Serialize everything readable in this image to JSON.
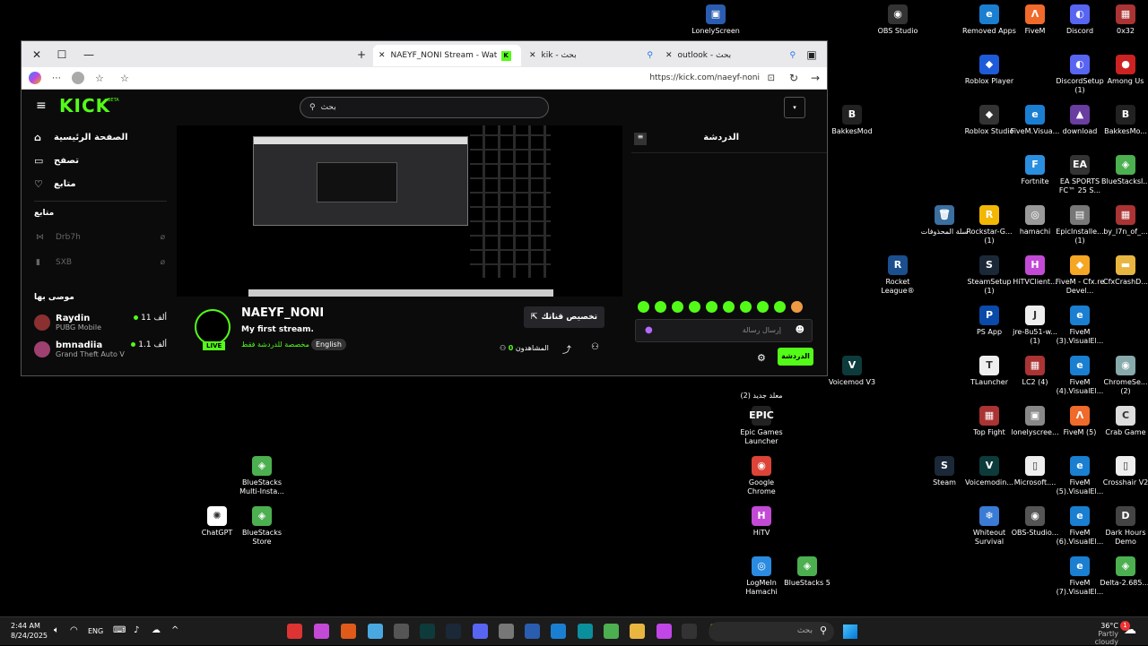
{
  "desktop_icons": [
    {
      "label": "LonelyScreen",
      "color": "#2a5db0",
      "glyph": "▣"
    },
    {
      "label": "OBS Studio",
      "color": "#333",
      "glyph": "◉"
    },
    {
      "label": "Removed Apps",
      "color": "#1a7fd1",
      "glyph": "e"
    },
    {
      "label": "FiveM",
      "color": "#f06a2b",
      "glyph": "Λ"
    },
    {
      "label": "Discord",
      "color": "#5865f2",
      "glyph": "◐"
    },
    {
      "label": "0x32",
      "color": "#a33",
      "glyph": "▦"
    },
    {
      "label": "Roblox Player",
      "color": "#1e5bd8",
      "glyph": "◆"
    },
    {
      "label": "DiscordSetup (1)",
      "color": "#5865f2",
      "glyph": "◐"
    },
    {
      "label": "Among Us",
      "color": "#c22",
      "glyph": "●"
    },
    {
      "label": "BakkesMod",
      "color": "#222",
      "glyph": "B"
    },
    {
      "label": "Roblox Studio",
      "color": "#333",
      "glyph": "◆"
    },
    {
      "label": "FiveM.Visua...",
      "color": "#1a7fd1",
      "glyph": "e"
    },
    {
      "label": "download",
      "color": "#6a3da0",
      "glyph": "▲"
    },
    {
      "label": "BakkesMo...",
      "color": "#222",
      "glyph": "B"
    },
    {
      "label": "Fortnite",
      "color": "#2b8fe0",
      "glyph": "F"
    },
    {
      "label": "EA SPORTS FC™ 25 S...",
      "color": "#333",
      "glyph": "EA"
    },
    {
      "label": "BlueStacksI...",
      "color": "#4caf50",
      "glyph": "◈"
    },
    {
      "label": "سلة المحذوفات",
      "color": "#3a6fa0",
      "glyph": "🗑"
    },
    {
      "label": "Rockstar-G... (1)",
      "color": "#f2b705",
      "glyph": "R"
    },
    {
      "label": "hamachi",
      "color": "#999",
      "glyph": "◎"
    },
    {
      "label": "EpicInstalle... (1)",
      "color": "#777",
      "glyph": "▤"
    },
    {
      "label": "by_l7n_of_...",
      "color": "#a33",
      "glyph": "▦"
    },
    {
      "label": "Rocket League®",
      "color": "#1b4f8f",
      "glyph": "R"
    },
    {
      "label": "SteamSetup (1)",
      "color": "#1b2838",
      "glyph": "S"
    },
    {
      "label": "HiTVClient...",
      "color": "#c34ad6",
      "glyph": "H"
    },
    {
      "label": "FiveM - Cfx.re Devel...",
      "color": "#f5a623",
      "glyph": "◆"
    },
    {
      "label": "CfxCrashD...",
      "color": "#e8b640",
      "glyph": "▬"
    },
    {
      "label": "PS App",
      "color": "#0a4aa8",
      "glyph": "P"
    },
    {
      "label": "jre-8u51-w... (1)",
      "color": "#eee",
      "glyph": "J"
    },
    {
      "label": "FiveM (3).VisualEl...",
      "color": "#1a7fd1",
      "glyph": "e"
    },
    {
      "label": "Voicemod V3",
      "color": "#0d3b3b",
      "glyph": "V"
    },
    {
      "label": "معلد جديد (2)",
      "color": "#000",
      "glyph": ""
    },
    {
      "label": "TLauncher",
      "color": "#eee",
      "glyph": "T"
    },
    {
      "label": "LC2 (4)",
      "color": "#a33",
      "glyph": "▦"
    },
    {
      "label": "FiveM (4).VisualEl...",
      "color": "#1a7fd1",
      "glyph": "e"
    },
    {
      "label": "ChromeSe... (2)",
      "color": "#8aa",
      "glyph": "◉"
    },
    {
      "label": "Epic Games Launcher",
      "color": "#222",
      "glyph": "EPIC"
    },
    {
      "label": "Top Fight",
      "color": "#a33",
      "glyph": "▦"
    },
    {
      "label": "lonelyscree...",
      "color": "#888",
      "glyph": "▣"
    },
    {
      "label": "FiveM (5)",
      "color": "#f06a2b",
      "glyph": "Λ"
    },
    {
      "label": "Crab Game",
      "color": "#ddd",
      "glyph": "C"
    },
    {
      "label": "BlueStacks Multi-Insta...",
      "color": "#4caf50",
      "glyph": "◈"
    },
    {
      "label": "Google Chrome",
      "color": "#db4437",
      "glyph": "◉"
    },
    {
      "label": "Steam",
      "color": "#1b2838",
      "glyph": "S"
    },
    {
      "label": "Voicemodin...",
      "color": "#0d3b3b",
      "glyph": "V"
    },
    {
      "label": "Microsoft....",
      "color": "#eee",
      "glyph": "▯"
    },
    {
      "label": "FiveM (5).VisualEl...",
      "color": "#1a7fd1",
      "glyph": "e"
    },
    {
      "label": "Crosshair V2",
      "color": "#eee",
      "glyph": "▯"
    },
    {
      "label": "ChatGPT",
      "color": "#fff",
      "glyph": "✺"
    },
    {
      "label": "BlueStacks Store",
      "color": "#4caf50",
      "glyph": "◈"
    },
    {
      "label": "HiTV",
      "color": "#c34ad6",
      "glyph": "H"
    },
    {
      "label": "Whiteout Survival",
      "color": "#3a7bd5",
      "glyph": "❄"
    },
    {
      "label": "OBS-Studio...",
      "color": "#555",
      "glyph": "◉"
    },
    {
      "label": "FiveM (6).VisualEl...",
      "color": "#1a7fd1",
      "glyph": "e"
    },
    {
      "label": "Dark Hours Demo",
      "color": "#444",
      "glyph": "D"
    },
    {
      "label": "LogMeIn Hamachi",
      "color": "#2a8be0",
      "glyph": "◎"
    },
    {
      "label": "BlueStacks 5",
      "color": "#4caf50",
      "glyph": "◈"
    },
    {
      "label": "FiveM (7).VisualEl...",
      "color": "#1a7fd1",
      "glyph": "e"
    },
    {
      "label": "Delta-2.685....",
      "color": "#4caf50",
      "glyph": "◈"
    }
  ],
  "browser": {
    "tabs": [
      "NAEYF_NONI Stream - Watch Live",
      "kik - بحث",
      "outlook - بحث"
    ],
    "url": "https://kick.com/naeyf-noni"
  },
  "kick": {
    "logo": "KICK",
    "logo_badge": "BETA",
    "search_placeholder": "بحث",
    "nav": [
      {
        "label": "الصفحة الرئيسية",
        "icon": "⌂"
      },
      {
        "label": "تصفح",
        "icon": "▭"
      },
      {
        "label": "متابع",
        "icon": "♡"
      }
    ],
    "following_title": "متابع",
    "following": [
      {
        "name": "Drb7h"
      },
      {
        "name": "SXB"
      }
    ],
    "recommended_title": "موصى بها",
    "recommended": [
      {
        "name": "Raydin",
        "game": "PUBG Mobile",
        "viewers": "11 ألف"
      },
      {
        "name": "bmnadiia",
        "game": "Grand Theft Auto V",
        "viewers": "1.1 ألف"
      }
    ],
    "channel": "NAEYF_NONI",
    "title": "My first stream.",
    "tag_text": "مخصصة للدردشة فقط",
    "language": "English",
    "live_badge": "LIVE",
    "customize_button": "تخصيص قناتك",
    "viewers_label": "المشاهدون",
    "viewers_count": "0",
    "chat_title": "الدردشة",
    "chat_placeholder": "إرسال رسالة",
    "chat_button": "الدردشة"
  },
  "taskbar": {
    "time": "2:44 AM",
    "date": "8/24/2025",
    "lang": "ENG",
    "search_placeholder": "بحث",
    "weather_temp": "36°C",
    "weather_desc": "Partly cloudy",
    "notif_count": "1"
  }
}
